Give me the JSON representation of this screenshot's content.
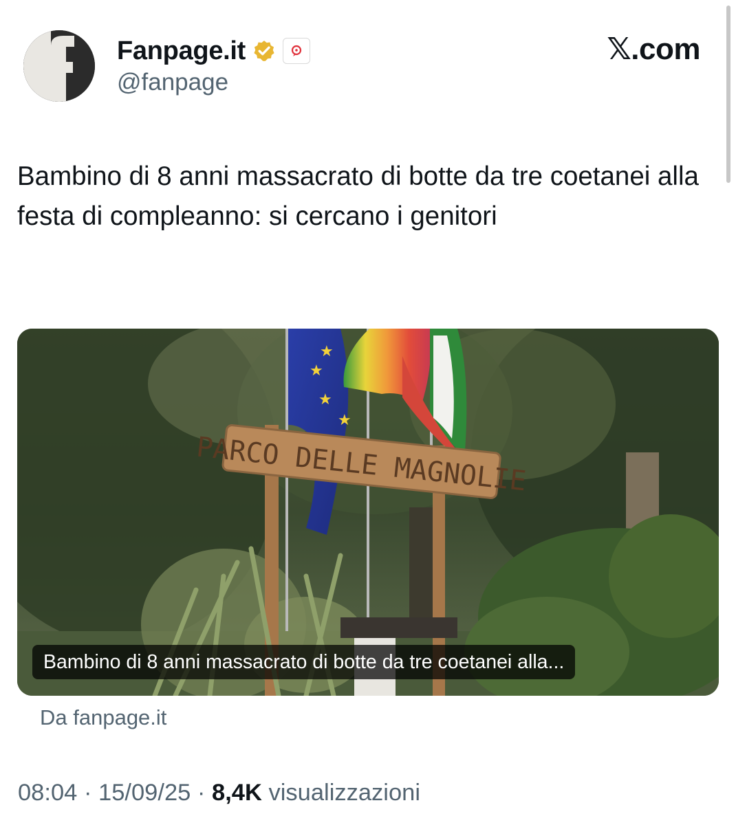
{
  "author": {
    "display_name": "Fanpage.it",
    "handle": "@fanpage",
    "avatar_icon": "fanpage-f-logo-icon",
    "verified_icon": "gold-verified-badge-icon",
    "affiliate_icon": "affiliate-badge-icon"
  },
  "brand": {
    "mark": "𝕏",
    "suffix": ".com"
  },
  "tweet": {
    "text": "Bambino di 8 anni massacrato di botte da tre coetanei alla festa di compleanno: si cercano i genitori"
  },
  "card": {
    "caption": "Bambino di 8 anni massacrato di botte da tre coetanei alla...",
    "source": "Da fanpage.it",
    "image_sign_text": "PARCO DELLE MAGNOLIE"
  },
  "meta": {
    "time": "08:04",
    "separator": "·",
    "date": "15/09/25",
    "views_count": "8,4K",
    "views_label": "visualizzazioni"
  },
  "colors": {
    "text_primary": "#0f1419",
    "text_secondary": "#536471",
    "verified_gold": "#e8b632"
  }
}
